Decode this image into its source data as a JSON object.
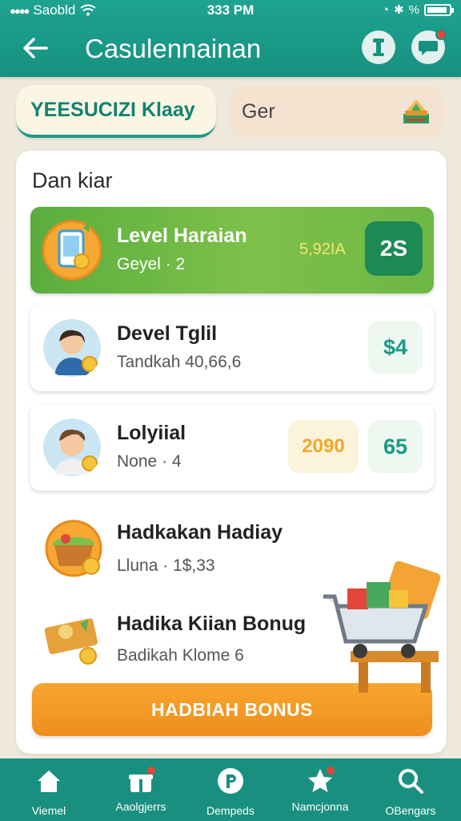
{
  "status_bar": {
    "carrier": "Saobld",
    "time": "333 PM",
    "right_text": "%"
  },
  "header": {
    "title": "Casulennainan"
  },
  "tabs": [
    {
      "label": "YEESUCIZI Klaay",
      "active": true
    },
    {
      "label": "Ger",
      "active": false
    }
  ],
  "panel": {
    "title": "Dan kiar",
    "rows": [
      {
        "title": "Level Haraian",
        "subtitle": "Geyel · 2",
        "value": "5,92IA",
        "badge": "2S",
        "highlighted": true
      },
      {
        "title": "Devel Tglil",
        "subtitle": "Tandkah 40,66,6",
        "badge": "$4"
      },
      {
        "title": "Lolyiial",
        "subtitle": "None · 4",
        "value": "2090",
        "badge": "65"
      }
    ],
    "bonus_items": [
      {
        "title": "Hadkakan Hadiay",
        "subtitle": "Lluna · 1$,33"
      },
      {
        "title": "Hadika Kiian Bonug",
        "subtitle": "Badikah Klome 6"
      }
    ],
    "cta_label": "HADBIAH BONUS"
  },
  "bottom_nav": [
    {
      "label": "Viemel",
      "icon": "home-icon",
      "dot": false
    },
    {
      "label": "Aaolgjerrs",
      "icon": "gift-icon",
      "dot": true
    },
    {
      "label": "Dempeds",
      "icon": "points-icon",
      "dot": false
    },
    {
      "label": "Namcjonna",
      "icon": "star-icon",
      "dot": true
    },
    {
      "label": "OBengars",
      "icon": "search-icon",
      "dot": false
    }
  ],
  "colors": {
    "primary": "#16917f",
    "accent_green": "#5aae3e",
    "cta_orange": "#ef8e1c",
    "notification": "#e2463b",
    "badge_teal_text": "#1a9a87",
    "value_yellow": "#f0a92b"
  }
}
